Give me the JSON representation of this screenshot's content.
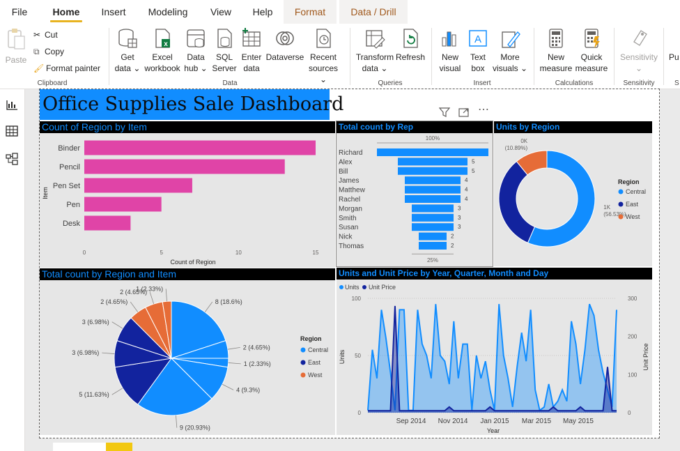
{
  "menu": {
    "tabs": [
      "File",
      "Home",
      "Insert",
      "Modeling",
      "View",
      "Help",
      "Format",
      "Data / Drill"
    ],
    "active": "Home"
  },
  "ribbon": {
    "clipboard": {
      "paste": "Paste",
      "cut": "Cut",
      "copy": "Copy",
      "format_painter": "Format painter",
      "group": "Clipboard"
    },
    "data": {
      "get_data": [
        "Get",
        "data ⌄"
      ],
      "excel": [
        "Excel",
        "workbook"
      ],
      "data_hub": [
        "Data",
        "hub ⌄"
      ],
      "sql": [
        "SQL",
        "Server"
      ],
      "enter_data": [
        "Enter",
        "data"
      ],
      "dataverse": "Dataverse",
      "recent": [
        "Recent",
        "sources ⌄"
      ],
      "group": "Data"
    },
    "queries": {
      "transform": [
        "Transform",
        "data ⌄"
      ],
      "refresh": "Refresh",
      "group": "Queries"
    },
    "insert": {
      "new_visual": [
        "New",
        "visual"
      ],
      "text_box": [
        "Text",
        "box"
      ],
      "more_visuals": [
        "More",
        "visuals ⌄"
      ],
      "group": "Insert"
    },
    "calculations": {
      "new_measure": [
        "New",
        "measure"
      ],
      "quick_measure": [
        "Quick",
        "measure"
      ],
      "group": "Calculations"
    },
    "sensitivity": {
      "label": "Sensitivity",
      "group": "Sensitivity"
    },
    "overflow": {
      "label": "Pu",
      "group": "S"
    }
  },
  "dashboard": {
    "title": "Office Supplies Sale Dashboard"
  },
  "colors": {
    "central": "#118dff",
    "east": "#12239e",
    "west": "#e66c37",
    "pink": "#e044a7",
    "brand": "#118dff"
  },
  "chart_data": [
    {
      "type": "bar",
      "title": "Count of Region by Item",
      "orientation": "horizontal",
      "categories": [
        "Binder",
        "Pencil",
        "Pen Set",
        "Pen",
        "Desk"
      ],
      "values": [
        15,
        13,
        7,
        5,
        3
      ],
      "xlabel": "Count of Region",
      "ylabel": "Item",
      "xticks": [
        0,
        5,
        10,
        15
      ],
      "xlim": [
        0,
        15
      ]
    },
    {
      "type": "bar",
      "subtype": "funnel",
      "title": "Total count by Rep",
      "categories": [
        "Richard",
        "Alex",
        "Bill",
        "James",
        "Matthew",
        "Rachel",
        "Morgan",
        "Smith",
        "Susan",
        "Nick",
        "Thomas"
      ],
      "values": [
        8,
        5,
        5,
        4,
        4,
        4,
        3,
        3,
        3,
        2,
        2
      ],
      "top_label": "100%",
      "bottom_label": "25%"
    },
    {
      "type": "pie",
      "subtype": "donut",
      "title": "Units by Region",
      "legend_title": "Region",
      "categories": [
        "Central",
        "East",
        "West"
      ],
      "values": [
        56.53,
        32.58,
        10.89
      ],
      "labels": [
        "1K\n(56.53%)",
        "1K\n(32.5...)",
        "0K\n(10.89%)"
      ],
      "legend": "right"
    },
    {
      "type": "pie",
      "title": "Total count by Region and Item",
      "legend_title": "Region",
      "legend_items": [
        "Central",
        "East",
        "West"
      ],
      "legend": "right",
      "slices": [
        {
          "region": "Central",
          "count": 8,
          "label": "8 (18.6%)"
        },
        {
          "region": "Central",
          "count": 2,
          "label": "2 (4.65%)"
        },
        {
          "region": "Central",
          "count": 1,
          "label": "1 (2.33%)"
        },
        {
          "region": "Central",
          "count": 4,
          "label": "4 (9.3%)"
        },
        {
          "region": "Central",
          "count": 9,
          "label": "9 (20.93%)"
        },
        {
          "region": "East",
          "count": 5,
          "label": "5 (11.63%)"
        },
        {
          "region": "East",
          "count": 3,
          "label": "3 (6.98%)"
        },
        {
          "region": "East",
          "count": 3,
          "label": "3 (6.98%)"
        },
        {
          "region": "West",
          "count": 2,
          "label": "2 (4.65%)"
        },
        {
          "region": "West",
          "count": 2,
          "label": "2 (4.65%)"
        },
        {
          "region": "West",
          "count": 1,
          "label": "1 (2.33%)"
        }
      ]
    },
    {
      "type": "area",
      "title": "Units and Unit Price by Year, Quarter, Month and Day",
      "legend": "top-left",
      "xlabel": "Year",
      "ylabel": "Units",
      "y2label": "Unit Price",
      "xticks": [
        "Sep 2014",
        "Nov 2014",
        "Jan 2015",
        "Mar 2015",
        "May 2015"
      ],
      "yticks": [
        0,
        50,
        100
      ],
      "y2ticks": [
        0,
        100,
        200,
        300
      ],
      "ylim": [
        0,
        100
      ],
      "y2lim": [
        0,
        300
      ],
      "series": [
        {
          "name": "Units",
          "axis": "left",
          "values": [
            2,
            55,
            30,
            90,
            65,
            35,
            2,
            90,
            90,
            2,
            2,
            90,
            60,
            50,
            30,
            95,
            50,
            45,
            25,
            80,
            30,
            60,
            60,
            2,
            50,
            30,
            45,
            20,
            2,
            95,
            50,
            30,
            5,
            40,
            70,
            45,
            90,
            20,
            2,
            5,
            25,
            5,
            10,
            20,
            10,
            80,
            60,
            25,
            55,
            95,
            85,
            55,
            35,
            20,
            5,
            90
          ]
        },
        {
          "name": "Unit Price",
          "axis": "right",
          "values": [
            5,
            5,
            5,
            5,
            5,
            5,
            280,
            5,
            5,
            5,
            5,
            5,
            5,
            5,
            5,
            5,
            5,
            5,
            15,
            5,
            5,
            5,
            5,
            5,
            5,
            5,
            5,
            15,
            5,
            5,
            5,
            5,
            5,
            5,
            5,
            5,
            5,
            5,
            5,
            5,
            5,
            15,
            5,
            5,
            5,
            5,
            5,
            15,
            5,
            5,
            5,
            5,
            5,
            120,
            5,
            5
          ]
        }
      ]
    }
  ]
}
